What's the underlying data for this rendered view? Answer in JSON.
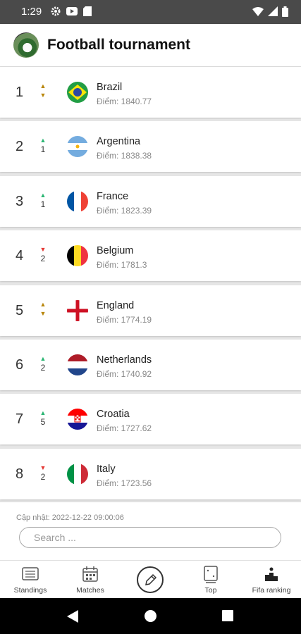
{
  "status_bar": {
    "time": "1:29"
  },
  "app": {
    "title": "Football tournament"
  },
  "points_prefix": "Điểm: ",
  "rankings": [
    {
      "rank": "1",
      "trend": "same",
      "change": "",
      "team": "Brazil",
      "points": "1840.77",
      "flag": "brazil-flag"
    },
    {
      "rank": "2",
      "trend": "up",
      "change": "1",
      "team": "Argentina",
      "points": "1838.38",
      "flag": "argentina-flag"
    },
    {
      "rank": "3",
      "trend": "up",
      "change": "1",
      "team": "France",
      "points": "1823.39",
      "flag": "france-flag"
    },
    {
      "rank": "4",
      "trend": "down",
      "change": "2",
      "team": "Belgium",
      "points": "1781.3",
      "flag": "belgium-flag"
    },
    {
      "rank": "5",
      "trend": "same",
      "change": "",
      "team": "England",
      "points": "1774.19",
      "flag": "england-flag"
    },
    {
      "rank": "6",
      "trend": "up",
      "change": "2",
      "team": "Netherlands",
      "points": "1740.92",
      "flag": "netherlands-flag"
    },
    {
      "rank": "7",
      "trend": "up",
      "change": "5",
      "team": "Croatia",
      "points": "1727.62",
      "flag": "croatia-flag"
    },
    {
      "rank": "8",
      "trend": "down",
      "change": "2",
      "team": "Italy",
      "points": "1723.56",
      "flag": "italy-flag"
    }
  ],
  "footer": {
    "updated": "Cập nhật: 2022-12-22 09:00:06",
    "search_placeholder": "Search ..."
  },
  "nav": [
    {
      "label": "Standings",
      "icon": "standings-icon"
    },
    {
      "label": "Matches",
      "icon": "calendar-icon"
    },
    {
      "label": "",
      "icon": "pencil-icon"
    },
    {
      "label": "Top",
      "icon": "top-icon"
    },
    {
      "label": "Fifa ranking",
      "icon": "podium-icon"
    }
  ],
  "colors": {
    "up": "#2bb673",
    "down": "#e53935",
    "same": "#b8860b"
  }
}
